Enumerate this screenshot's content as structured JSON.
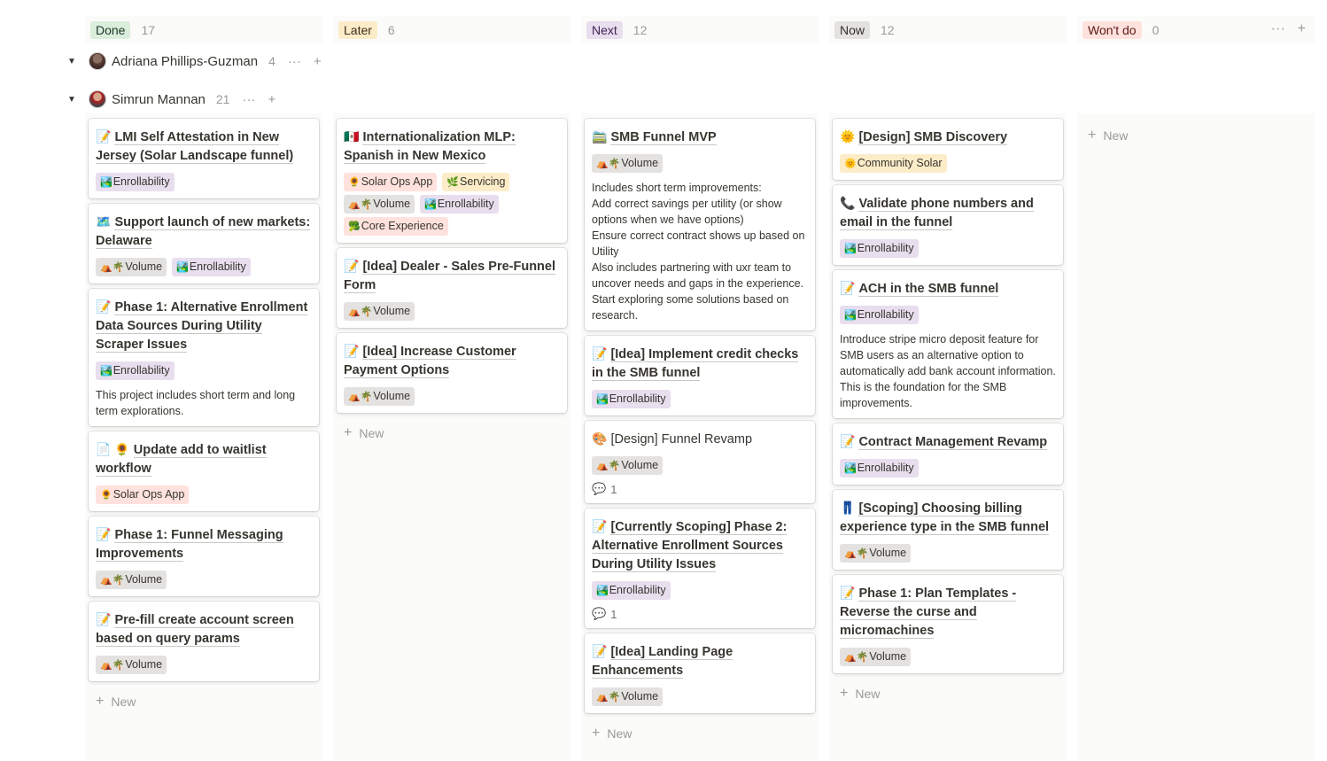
{
  "columns": [
    {
      "status": "Done",
      "count": "17",
      "pill_bg": "#dbeddb",
      "pill_fg": "#1c3829"
    },
    {
      "status": "Later",
      "count": "6",
      "pill_bg": "#fdecc8",
      "pill_fg": "#402c1b"
    },
    {
      "status": "Next",
      "count": "12",
      "pill_bg": "#e8deee",
      "pill_fg": "#412454"
    },
    {
      "status": "Now",
      "count": "12",
      "pill_bg": "#e3e2e0",
      "pill_fg": "#32302c"
    },
    {
      "status": "Won't do",
      "count": "0",
      "pill_bg": "#ffe2dd",
      "pill_fg": "#5d1715"
    }
  ],
  "header_actions": {
    "more": "···",
    "add": "+"
  },
  "groups": [
    {
      "name": "Adriana Phillips-Guzman",
      "count": "4"
    },
    {
      "name": "Simrun Mannan",
      "count": "21"
    }
  ],
  "group_actions": {
    "more": "···",
    "add": "+"
  },
  "new_label": "New",
  "done_cards": [
    {
      "icon": "document-arrow-icon",
      "glyph": "📝",
      "title": "LMI Self Attestation in New Jersey (Solar Landscape funnel)",
      "tags": [
        "Enrollability"
      ]
    },
    {
      "icon": "map-icon",
      "glyph": "🗺️",
      "title": "Support launch of new markets: Delaware",
      "tags": [
        "Volume",
        "Enrollability"
      ]
    },
    {
      "icon": "document-arrow-icon",
      "glyph": "📝",
      "title": "Phase 1: Alternative Enrollment Data Sources During Utility Scraper Issues",
      "tags": [
        "Enrollability"
      ],
      "desc": "This project includes short term and long term explorations."
    },
    {
      "icon": "sunflower-icon",
      "glyph": "📄 🌻",
      "title": "Update add to waitlist workflow",
      "tags": [
        "Solar Ops App"
      ]
    },
    {
      "icon": "document-arrow-icon",
      "glyph": "📝",
      "title": "Phase 1: Funnel Messaging Improvements",
      "tags": [
        "Volume"
      ]
    },
    {
      "icon": "document-arrow-icon",
      "glyph": "📝",
      "title": "Pre-fill create account screen based on query params",
      "tags": [
        "Volume"
      ]
    }
  ],
  "later_cards": [
    {
      "icon": "mexico-flag-icon",
      "glyph": "🇲🇽",
      "title": "Internationalization MLP: Spanish in New Mexico",
      "tags": [
        "Solar Ops App",
        "Servicing",
        "Volume",
        "Enrollability",
        "Core Experience"
      ]
    },
    {
      "icon": "document-arrow-icon",
      "glyph": "📝",
      "title": "[Idea] Dealer - Sales Pre-Funnel Form",
      "tags": [
        "Volume"
      ]
    },
    {
      "icon": "document-arrow-icon",
      "glyph": "📝",
      "title": "[Idea] Increase Customer Payment Options",
      "tags": [
        "Volume"
      ]
    }
  ],
  "next_cards": [
    {
      "icon": "train-icon",
      "glyph": "🚞",
      "title": "SMB Funnel MVP",
      "tags": [
        "Volume"
      ],
      "desc": "Includes short term improvements:\nAdd correct savings per utility (or show options when we have options)\nEnsure correct contract shows up based on Utility\nAlso includes partnering with uxr team to uncover needs and gaps in the experience. Start exploring some solutions based on research."
    },
    {
      "icon": "document-arrow-icon",
      "glyph": "📝",
      "title": "[Idea] Implement credit checks in the SMB funnel",
      "tags": [
        "Enrollability"
      ]
    },
    {
      "icon": "palette-icon",
      "glyph": "🎨",
      "title": "[Design] Funnel Revamp",
      "tags": [
        "Volume"
      ],
      "comments": "1",
      "plain": true
    },
    {
      "icon": "document-arrow-icon",
      "glyph": "📝",
      "title": "[Currently Scoping] Phase 2: Alternative Enrollment Sources During Utility Issues",
      "tags": [
        "Enrollability"
      ],
      "comments": "1"
    },
    {
      "icon": "document-arrow-icon",
      "glyph": "📝",
      "title": "[Idea] Landing Page Enhancements",
      "tags": [
        "Volume"
      ]
    }
  ],
  "now_cards": [
    {
      "icon": "sun-icon",
      "glyph": "🌞",
      "title": "[Design] SMB Discovery",
      "tags": [
        "Community Solar"
      ]
    },
    {
      "icon": "phone-icon",
      "glyph": "📞",
      "title": "Validate phone numbers and email in the funnel",
      "tags": [
        "Enrollability"
      ]
    },
    {
      "icon": "document-arrow-icon",
      "glyph": "📝",
      "title": "ACH in the SMB funnel",
      "tags": [
        "Enrollability"
      ],
      "desc": "Introduce stripe micro deposit feature for SMB users as an alternative option to automatically add bank account information.  This is the foundation for the SMB improvements."
    },
    {
      "icon": "memo-icon",
      "glyph": "📝",
      "title": "Contract Management Revamp",
      "tags": [
        "Enrollability"
      ]
    },
    {
      "icon": "jeans-icon",
      "glyph": "👖",
      "title": "[Scoping] Choosing billing experience type in the SMB funnel",
      "tags": [
        "Volume"
      ]
    },
    {
      "icon": "document-arrow-icon",
      "glyph": "📝",
      "title": "Phase 1: Plan Templates - Reverse the curse and micromachines",
      "tags": [
        "Volume"
      ]
    }
  ],
  "tag_styles": {
    "Enrollability": {
      "cls": "t-enr",
      "glyph": "🏞️"
    },
    "Volume": {
      "cls": "t-vol",
      "glyph": "⛺🌴"
    },
    "Solar Ops App": {
      "cls": "t-sol",
      "glyph": "🌻"
    },
    "Servicing": {
      "cls": "t-ser",
      "glyph": "🌿"
    },
    "Core Experience": {
      "cls": "t-core",
      "glyph": "🥦"
    },
    "Community Solar": {
      "cls": "t-comm",
      "glyph": "🌞"
    }
  },
  "comment_icon": "💬"
}
